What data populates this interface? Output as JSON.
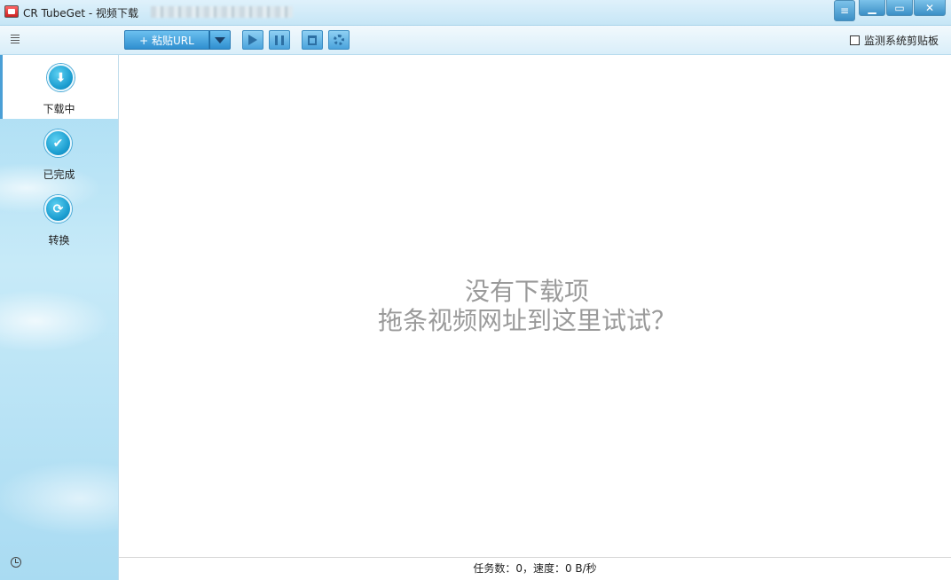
{
  "window": {
    "title": "CR TubeGet - 视频下载",
    "menu_icon": "menu-icon",
    "minimize_icon": "minimize-icon",
    "maximize_icon": "maximize-icon",
    "close_icon": "close-icon"
  },
  "toolbar": {
    "paste_url_label": "+ 粘贴URL",
    "monitor_clipboard_label": "监测系统剪贴板",
    "monitor_clipboard_checked": false
  },
  "sidebar": {
    "items": [
      {
        "label": "下载中",
        "icon": "download-icon",
        "active": true
      },
      {
        "label": "已完成",
        "icon": "checkmark-icon",
        "active": false
      },
      {
        "label": "转换",
        "icon": "convert-icon",
        "active": false
      }
    ]
  },
  "main": {
    "empty_line1": "没有下载项",
    "empty_line2": "拖条视频网址到这里试试？"
  },
  "status": {
    "text": "任务数：0，速度：0 B/秒"
  },
  "colors": {
    "accent": "#2f8fd0",
    "sidebar_bg": "#b5e1f5",
    "placeholder_text": "#9a9a9a"
  }
}
